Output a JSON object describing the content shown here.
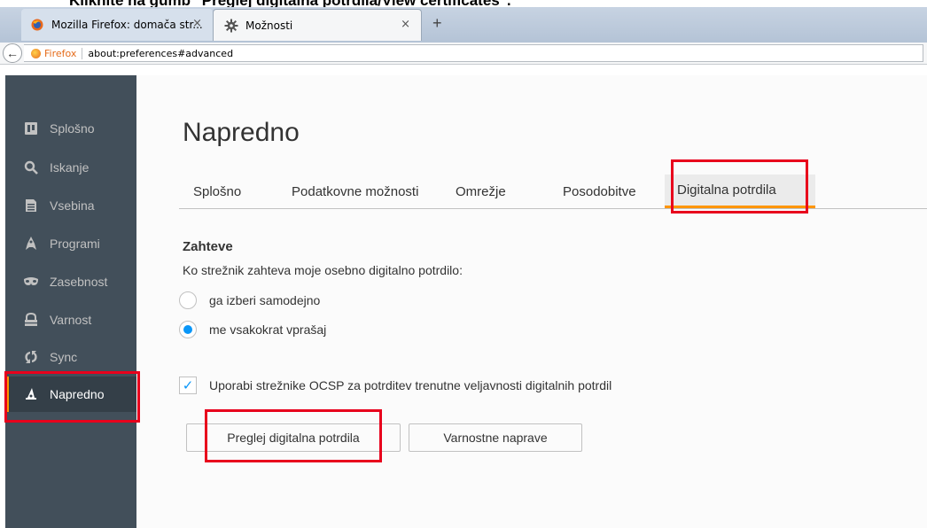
{
  "doc_caption": "Kliknite na gumb \"Preglej digitalna potrdila/View certificates\".",
  "tabs": [
    {
      "title": "Mozilla Firefox: domača str...",
      "close": "×"
    },
    {
      "title": "Možnosti",
      "close": "×"
    }
  ],
  "new_tab": "+",
  "navbar": {
    "back": "←",
    "brand": "Firefox",
    "url": "about:preferences#advanced"
  },
  "sidebar": {
    "items": [
      {
        "label": "Splošno",
        "icon": "general-icon"
      },
      {
        "label": "Iskanje",
        "icon": "search-icon"
      },
      {
        "label": "Vsebina",
        "icon": "content-icon"
      },
      {
        "label": "Programi",
        "icon": "applications-icon"
      },
      {
        "label": "Zasebnost",
        "icon": "privacy-mask-icon"
      },
      {
        "label": "Varnost",
        "icon": "security-lock-icon"
      },
      {
        "label": "Sync",
        "icon": "sync-icon"
      },
      {
        "label": "Napredno",
        "icon": "advanced-wizard-icon",
        "selected": true
      }
    ]
  },
  "main": {
    "title": "Napredno",
    "tabs": [
      "Splošno",
      "Podatkovne možnosti",
      "Omrežje",
      "Posodobitve",
      "Digitalna potrdila"
    ],
    "selected_tab": "Digitalna potrdila",
    "section_heading": "Zahteve",
    "description": "Ko strežnik zahteva moje osebno digitalno potrdilo:",
    "radios": [
      {
        "label": "ga izberi samodejno",
        "checked": false
      },
      {
        "label": "me vsakokrat vprašaj",
        "checked": true
      }
    ],
    "ocsp_checkbox": {
      "label": "Uporabi strežnike OCSP za potrditev trenutne veljavnosti digitalnih potrdil",
      "checked": true
    },
    "buttons": {
      "view_certificates": "Preglej digitalna potrdila",
      "security_devices": "Varnostne naprave"
    }
  },
  "colors": {
    "accent": "#ff9500",
    "highlight": "#e8001c",
    "sidebar_bg": "#424f5a",
    "radio_selected": "#0996f8"
  }
}
